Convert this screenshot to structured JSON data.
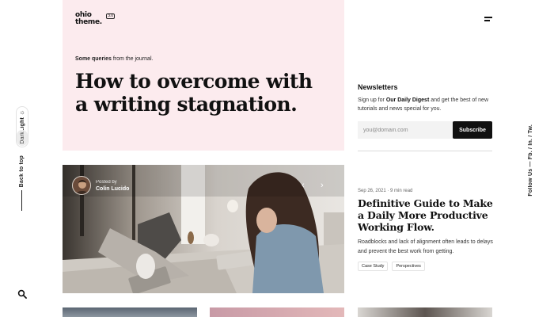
{
  "brand": {
    "logo_line1": "ohio",
    "logo_line2": "theme.",
    "badge": "3.0"
  },
  "left_rail": {
    "light_label": "Light",
    "dark_label": "Dark",
    "back_to_top": "Back to top"
  },
  "hero": {
    "kicker_bold": "Some queries",
    "kicker_rest": " from the journal.",
    "title": "How to overcome with a writing stagnation."
  },
  "newsletter": {
    "title": "Newsletters",
    "desc_pre": "Sign up for ",
    "desc_bold": "Our Daily Digest",
    "desc_post": " and get the best of new tutorials and news special for you.",
    "input_placeholder": "you@domain.com",
    "button_label": "Subscribe"
  },
  "feature": {
    "posted_by": "Posted by",
    "author": "Colin Lucido",
    "prev": "‹",
    "next": "›"
  },
  "article": {
    "meta": "Sep 26, 2021 · 9 min read",
    "title": "Definitive Guide to Make a Daily More Productive Working Flow.",
    "excerpt": "Roadblocks and lack of alignment often leads to delays and prevent the best work from getting.",
    "tags": [
      "Case Study",
      "Perspectives"
    ]
  },
  "right_rail": {
    "follow": "Follow Us — Fb. / In. / Tw."
  },
  "icons": {
    "theme": "sun-icon",
    "menu": "hamburger-menu-icon",
    "search": "search-icon"
  },
  "colors": {
    "hero_bg": "#fcebee",
    "button_bg": "#111111"
  }
}
